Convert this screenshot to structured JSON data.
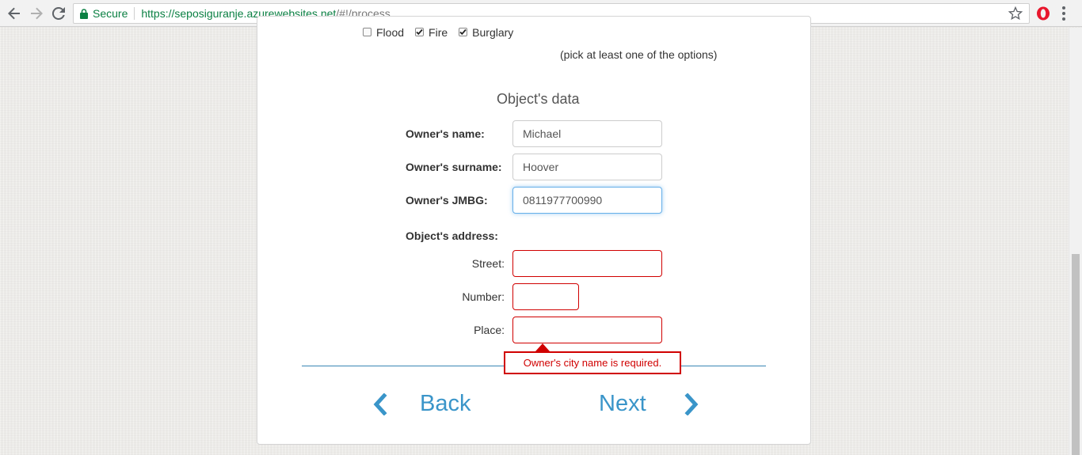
{
  "browser": {
    "secure_label": "Secure",
    "url_host": "https://seposiguranje.azurewebsites.net",
    "url_path": "/#!/process"
  },
  "insurance_types": [
    {
      "label": "Flood",
      "checked": false
    },
    {
      "label": "Fire",
      "checked": true
    },
    {
      "label": "Burglary",
      "checked": true
    }
  ],
  "insurance_hint": "(pick at least one of the options)",
  "section_title": "Object's data",
  "owner": {
    "name_label": "Owner's name:",
    "name_value": "Michael",
    "surname_label": "Owner's surname:",
    "surname_value": "Hoover",
    "jmbg_label": "Owner's JMBG:",
    "jmbg_value": "0811977700990"
  },
  "address": {
    "heading": "Object's address:",
    "street_label": "Street:",
    "street_value": "",
    "number_label": "Number:",
    "number_value": "",
    "place_label": "Place:",
    "place_value": ""
  },
  "error_message": "Owner's city name is required.",
  "navigation": {
    "back_label": "Back",
    "next_label": "Next"
  },
  "colors": {
    "accent": "#3a95c9",
    "error": "#d00000",
    "secure_green": "#0b8043"
  }
}
